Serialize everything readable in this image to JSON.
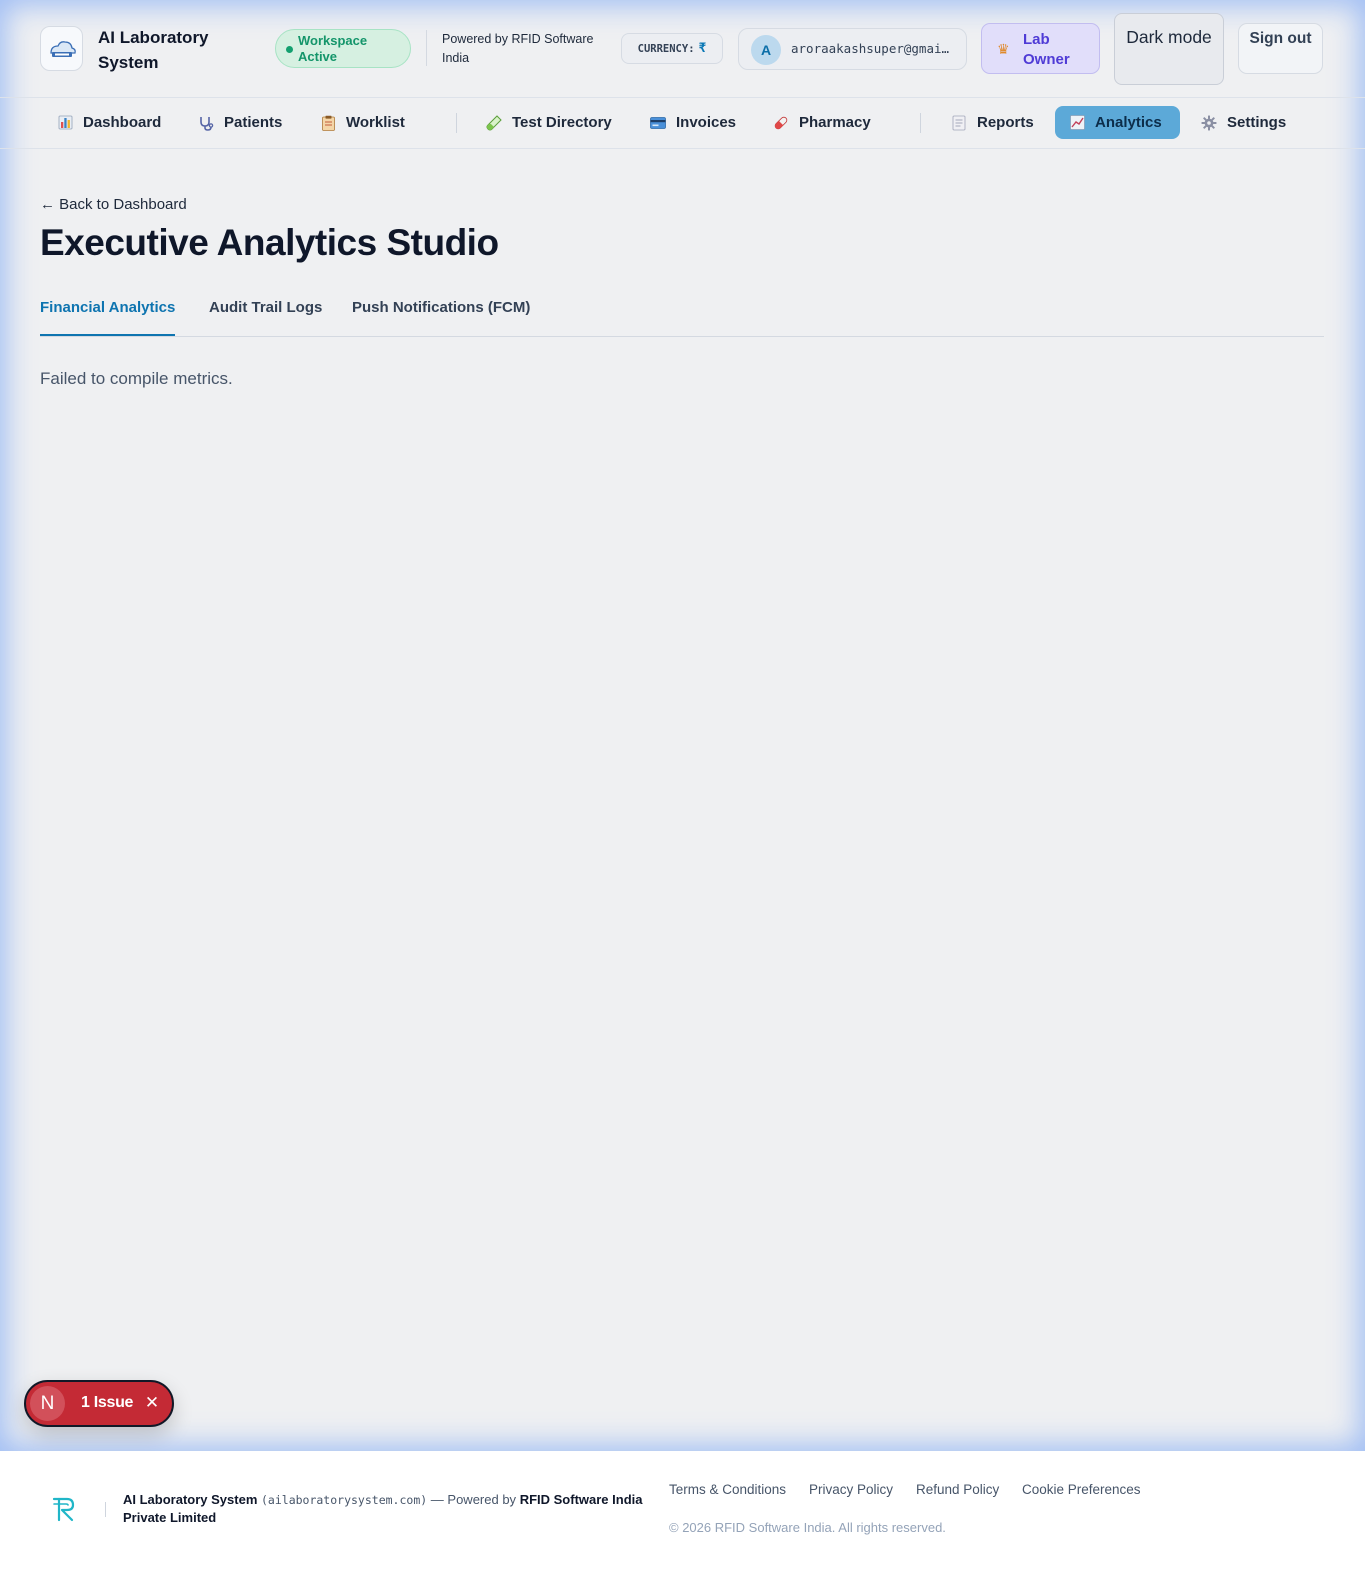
{
  "header": {
    "brand": "AI Laboratory System",
    "workspace_status": "Workspace Active",
    "powered_by": "Powered by RFID Software India",
    "currency_label": "CURRENCY:",
    "currency_symbol": "₹",
    "user": {
      "initial": "A",
      "email": "aroraakashsuper@gmai…"
    },
    "role": "Lab Owner",
    "dark_mode": "Dark mode",
    "sign_out": "Sign out"
  },
  "nav": {
    "items": [
      {
        "label": "Dashboard",
        "icon": "bar-chart-icon"
      },
      {
        "label": "Patients",
        "icon": "stethoscope-icon"
      },
      {
        "label": "Worklist",
        "icon": "clipboard-icon"
      },
      {
        "label": "Test Directory",
        "icon": "test-tube-icon"
      },
      {
        "label": "Invoices",
        "icon": "credit-card-icon"
      },
      {
        "label": "Pharmacy",
        "icon": "pill-icon"
      },
      {
        "label": "Reports",
        "icon": "document-icon"
      },
      {
        "label": "Analytics",
        "icon": "chart-up-icon",
        "active": true
      },
      {
        "label": "Settings",
        "icon": "gear-icon"
      }
    ]
  },
  "main": {
    "back_link": "← Back to Dashboard",
    "title": "Executive Analytics Studio",
    "tabs": [
      {
        "label": "Financial Analytics",
        "active": true
      },
      {
        "label": "Audit Trail Logs"
      },
      {
        "label": "Push Notifications (FCM)"
      }
    ],
    "error": "Failed to compile metrics."
  },
  "issue_badge": {
    "initial": "N",
    "label": "1 Issue"
  },
  "footer": {
    "brand": "AI Laboratory System",
    "domain": "(ailaboratorysystem.com)",
    "powered_prefix": "— Powered by",
    "company": "RFID Software India Private Limited",
    "links": [
      "Terms & Conditions",
      "Privacy Policy",
      "Refund Policy",
      "Cookie Preferences"
    ],
    "copyright": "© 2026 RFID Software India. All rights reserved."
  },
  "colors": {
    "accent": "#0e74b0",
    "active_nav": "#5ca9d8",
    "workspace_green": "#14956a",
    "role_purple": "#4f3bd6",
    "issue_red": "#c42a35"
  }
}
